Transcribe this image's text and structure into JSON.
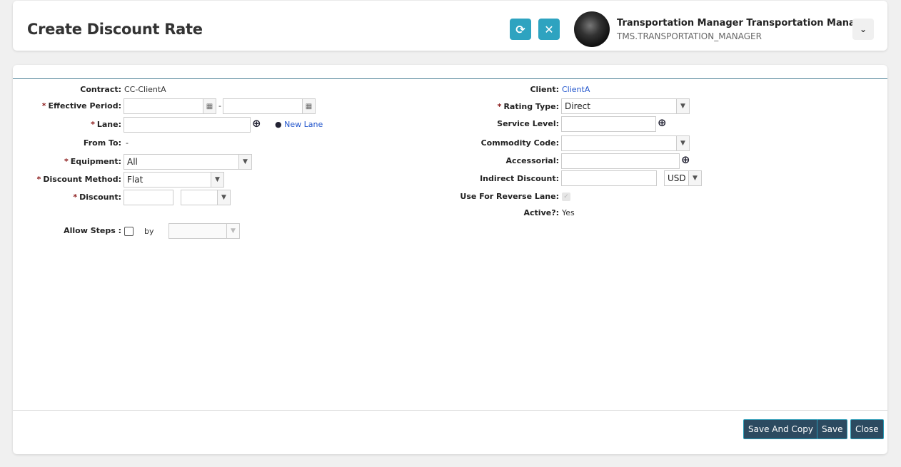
{
  "header": {
    "title": "Create Discount Rate",
    "refresh_icon": "refresh-icon",
    "close_icon": "close-icon",
    "user_name": "Transportation Manager Transportation Mana...",
    "user_id": "TMS.TRANSPORTATION_MANAGER"
  },
  "form": {
    "contract_label": "Contract:",
    "contract_value": "CC-ClientA",
    "effective_label": "Effective Period:",
    "effective_sep": "-",
    "effective_from": "",
    "effective_to": "",
    "lane_label": "Lane:",
    "lane_value": "",
    "new_lane": "New Lane",
    "fromto_label": "From To:",
    "fromto_value": "-",
    "equipment_label": "Equipment:",
    "equipment_value": "All",
    "method_label": "Discount Method:",
    "method_value": "Flat",
    "discount_label": "Discount:",
    "discount_value": "",
    "discount_unit": "",
    "steps_label": "Allow Steps :",
    "steps_by": "by",
    "steps_select": "",
    "client_label": "Client:",
    "client_value": "ClientA",
    "rating_label": "Rating Type:",
    "rating_value": "Direct",
    "service_label": "Service Level:",
    "service_value": "",
    "commodity_label": "Commodity Code:",
    "commodity_value": "",
    "accessorial_label": "Accessorial:",
    "accessorial_value": "",
    "indirect_label": "Indirect Discount:",
    "indirect_value": "",
    "currency": "USD",
    "reverse_label": "Use For Reverse Lane:",
    "active_label": "Active?:",
    "active_value": "Yes",
    "required_mark": "*"
  },
  "footer": {
    "save_copy": "Save And Copy",
    "save": "Save",
    "close": "Close"
  },
  "colors": {
    "accent": "#2ea3c0",
    "button": "#2c4a60"
  }
}
